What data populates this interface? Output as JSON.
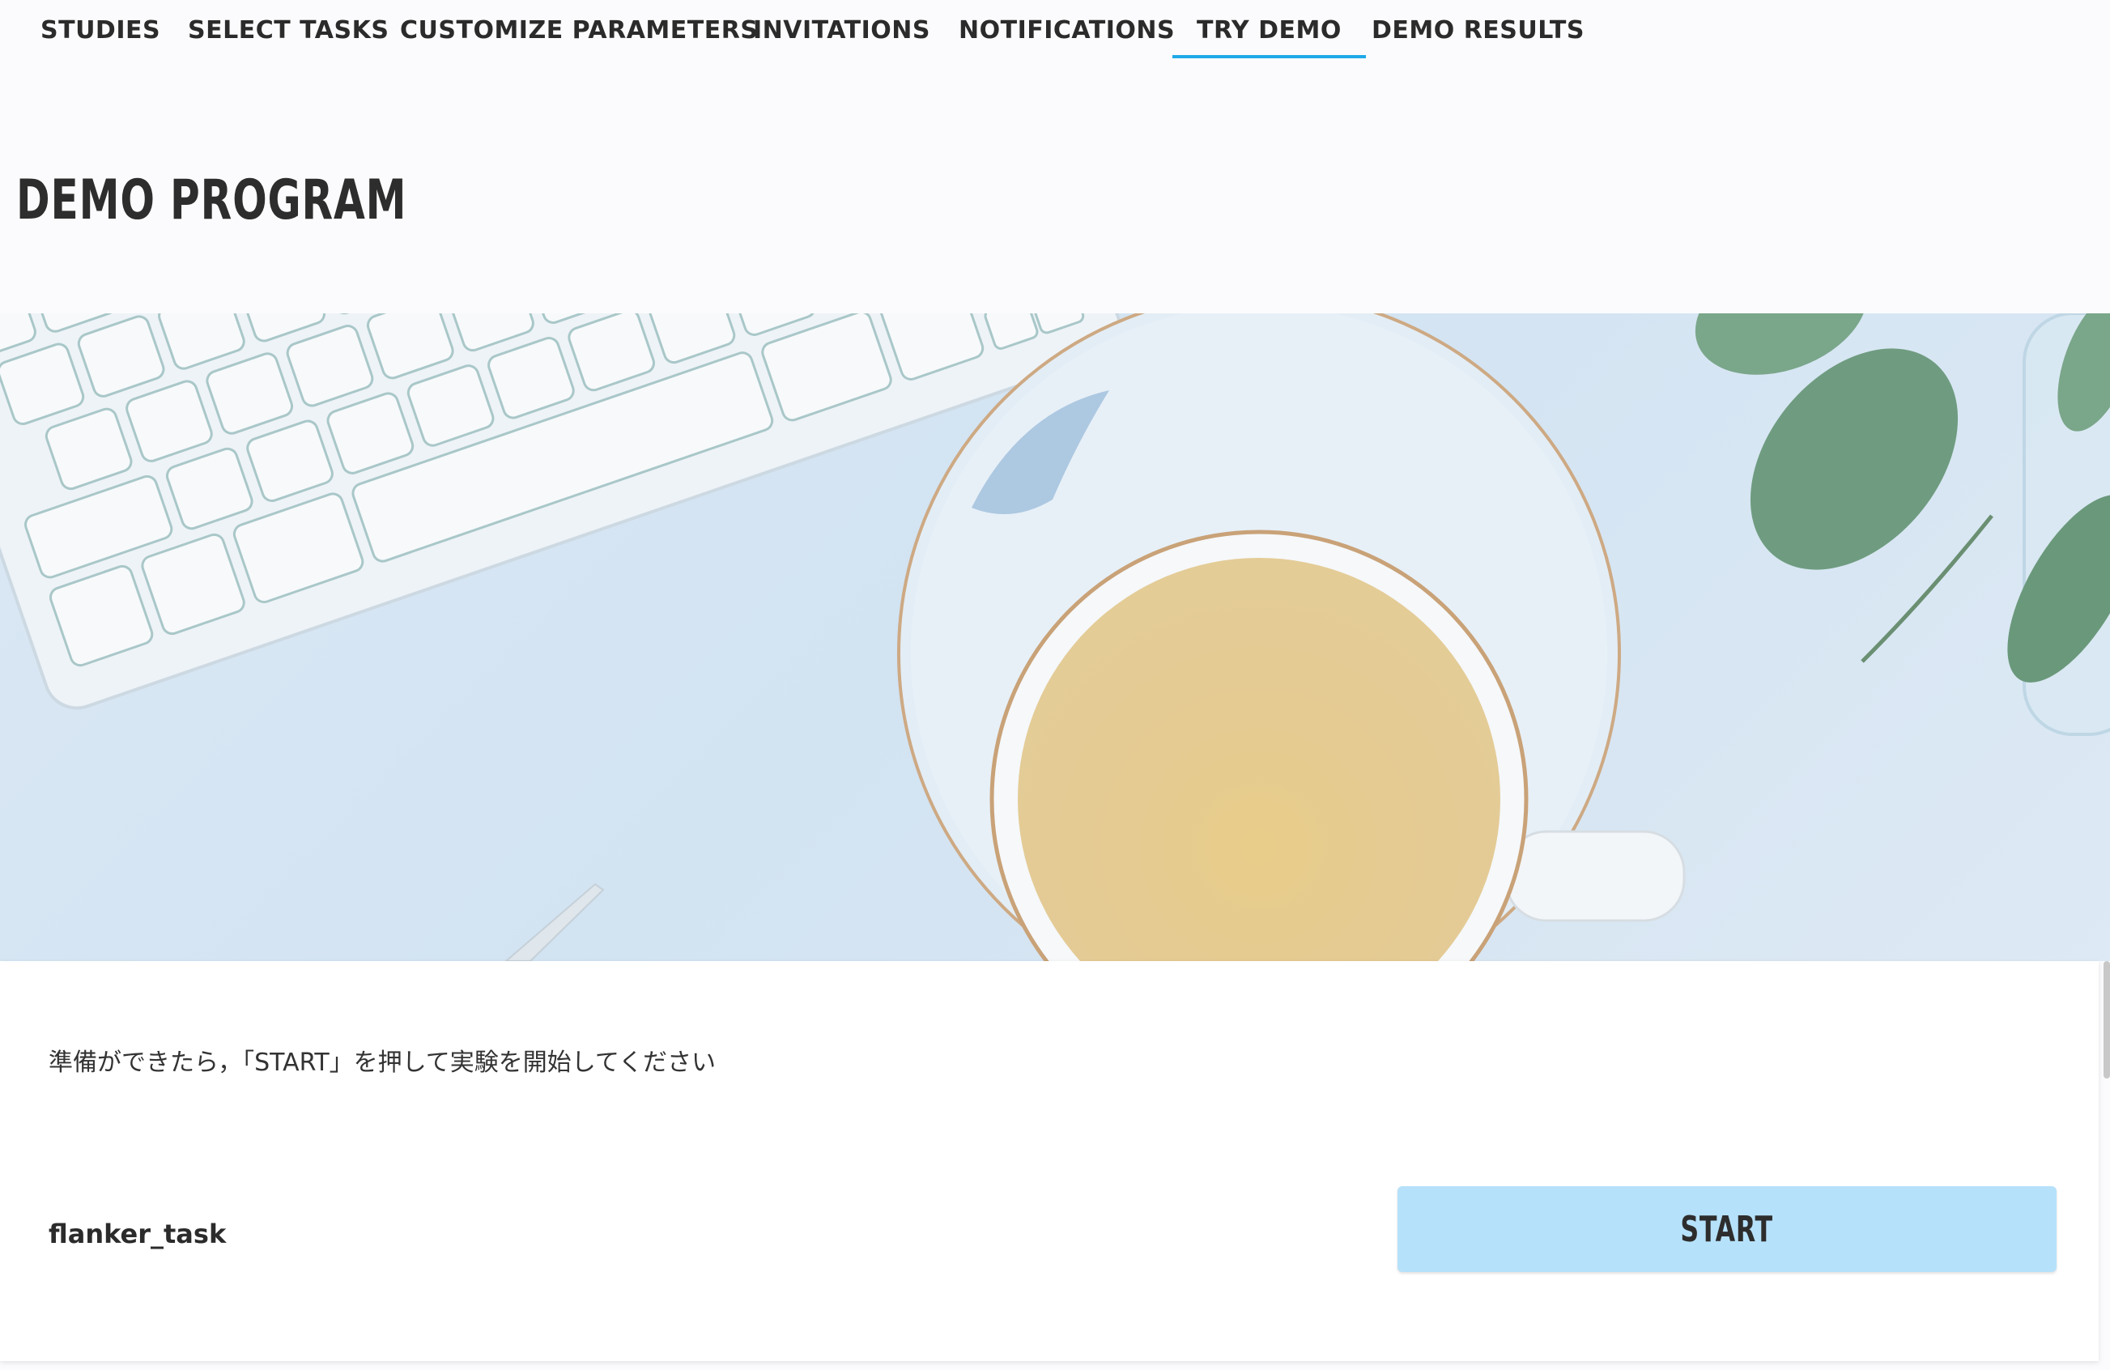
{
  "nav": {
    "tabs": [
      {
        "label": "STUDIES"
      },
      {
        "label": "SELECT TASKS"
      },
      {
        "label": "CUSTOMIZE PARAMETERS"
      },
      {
        "label": "INVITATIONS"
      },
      {
        "label": "NOTIFICATIONS"
      },
      {
        "label": "TRY DEMO",
        "active": true
      },
      {
        "label": "DEMO RESULTS"
      }
    ]
  },
  "page": {
    "title": "DEMO PROGRAM"
  },
  "demo_card": {
    "instruction": "準備ができたら，「START」を押して実験を開始してください",
    "task_name": "flanker_task",
    "start_label": "START"
  },
  "colors": {
    "active_tab_underline": "#1fa9e8",
    "start_button": "#b6e1fa",
    "background": "#fbfbfd"
  },
  "hero": {
    "icons": [
      "keyboard-icon",
      "tea-cup-icon",
      "leaf-plant-icon"
    ]
  }
}
